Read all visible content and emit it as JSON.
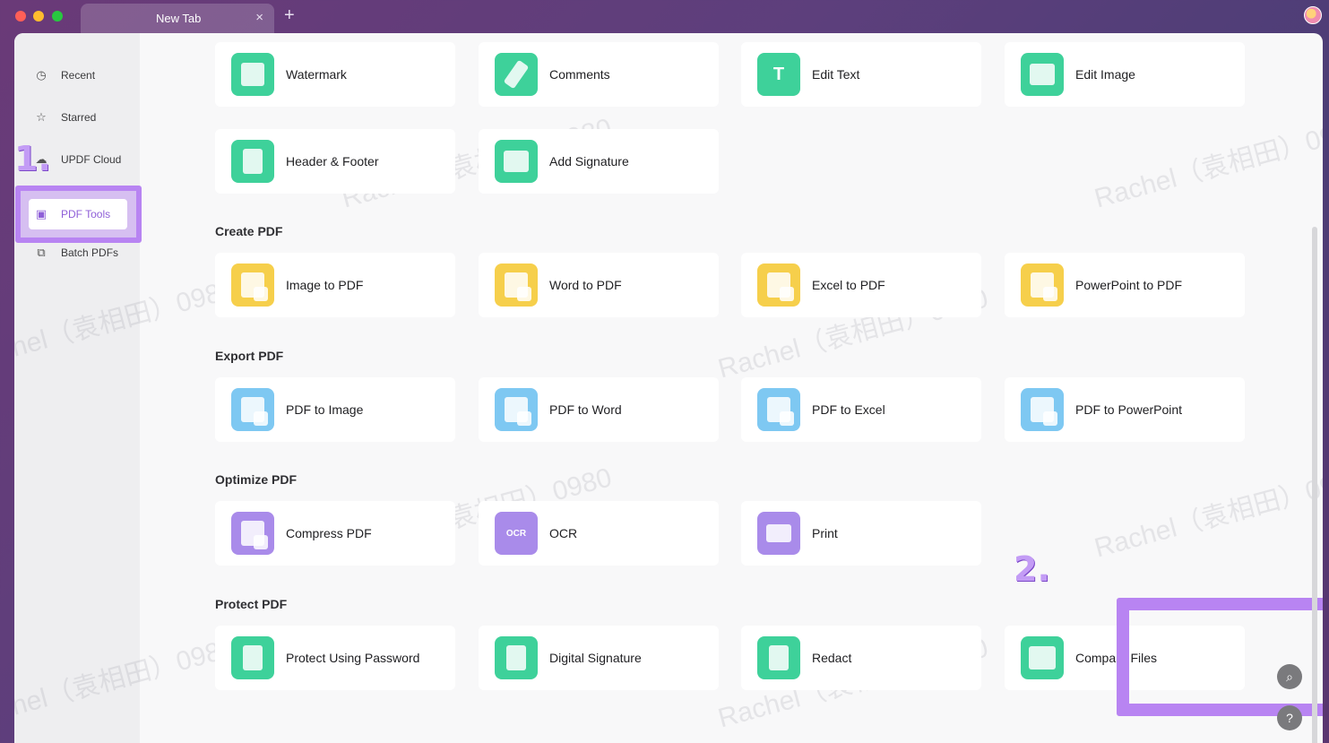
{
  "window": {
    "tab_title": "New Tab",
    "tab_close": "×",
    "tab_add": "+"
  },
  "sidebar": {
    "items": [
      {
        "label": "Recent",
        "icon": "clock-icon",
        "glyph": "◷"
      },
      {
        "label": "Starred",
        "icon": "star-icon",
        "glyph": "☆"
      },
      {
        "label": "UPDF Cloud",
        "icon": "cloud-icon",
        "glyph": "☁"
      },
      {
        "label": "PDF Tools",
        "icon": "toolbox-icon",
        "glyph": "▣"
      },
      {
        "label": "Batch PDFs",
        "icon": "batch-icon",
        "glyph": "⧉"
      }
    ]
  },
  "annotations": {
    "step1": "1.",
    "step2": "2."
  },
  "sections": {
    "create_pdf": "Create PDF",
    "export_pdf": "Export PDF",
    "optimize_pdf": "Optimize PDF",
    "protect_pdf": "Protect PDF"
  },
  "tools": {
    "watermark": "Watermark",
    "comments": "Comments",
    "edit_text": "Edit Text",
    "edit_image": "Edit Image",
    "header_footer": "Header & Footer",
    "add_signature": "Add Signature",
    "image_to_pdf": "Image to PDF",
    "word_to_pdf": "Word to PDF",
    "excel_to_pdf": "Excel to PDF",
    "powerpoint_to_pdf": "PowerPoint to PDF",
    "pdf_to_image": "PDF to Image",
    "pdf_to_word": "PDF to Word",
    "pdf_to_excel": "PDF to Excel",
    "pdf_to_powerpoint": "PDF to PowerPoint",
    "compress_pdf": "Compress PDF",
    "ocr": "OCR",
    "print": "Print",
    "protect_using_password": "Protect Using Password",
    "digital_signature": "Digital Signature",
    "redact": "Redact",
    "compare_files": "Compare Files"
  },
  "icon_glyphs": {
    "edit_text": "T",
    "ocr": "OCR",
    "search": "⌕",
    "help": "?"
  },
  "watermark_text": "Rachel（袁相田）0980",
  "colors": {
    "accent_purple": "#b884f2",
    "green_icon": "#3ed19a",
    "yellow_icon": "#f6cf4b",
    "blue_icon": "#7ec8f2",
    "purple_icon": "#a98bea"
  }
}
